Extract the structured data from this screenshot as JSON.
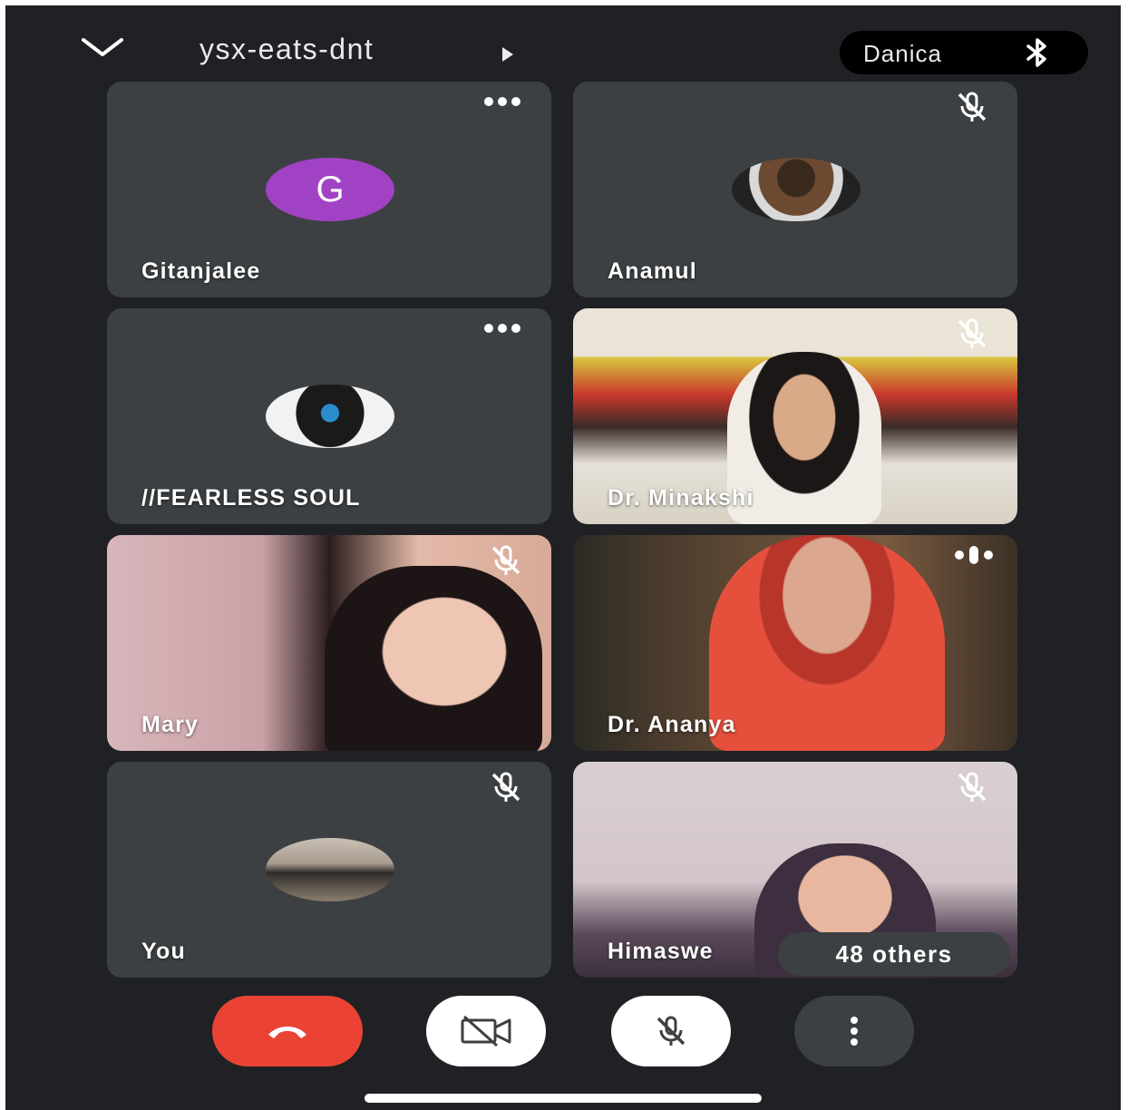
{
  "header": {
    "meeting_code": "ysx-eats-dnt",
    "audio_device": "Danica",
    "back_icon": "chevron-down-icon",
    "audio_icon": "bluetooth-icon"
  },
  "participants": [
    {
      "name": "Gitanjalee",
      "avatar_letter": "G",
      "avatar_color": "#a142c4",
      "state": "more-options"
    },
    {
      "name": "Anamul",
      "state": "muted"
    },
    {
      "name": "//FEARLESS SOUL",
      "state": "more-options"
    },
    {
      "name": "Dr. Minakshi",
      "state": "muted",
      "video": true
    },
    {
      "name": "Mary",
      "state": "muted",
      "video": true
    },
    {
      "name": "Dr. Ananya",
      "state": "speaking",
      "video": true
    },
    {
      "name": "You",
      "state": "muted"
    },
    {
      "name": "Himaswe",
      "state": "muted",
      "video": true
    }
  ],
  "others_label": "48 others",
  "controls": {
    "end_call_icon": "phone-hangup-icon",
    "end_call_color": "#ea4335",
    "camera_icon": "camera-off-icon",
    "mic_icon": "mic-off-icon",
    "more_icon": "more-vertical-icon"
  }
}
